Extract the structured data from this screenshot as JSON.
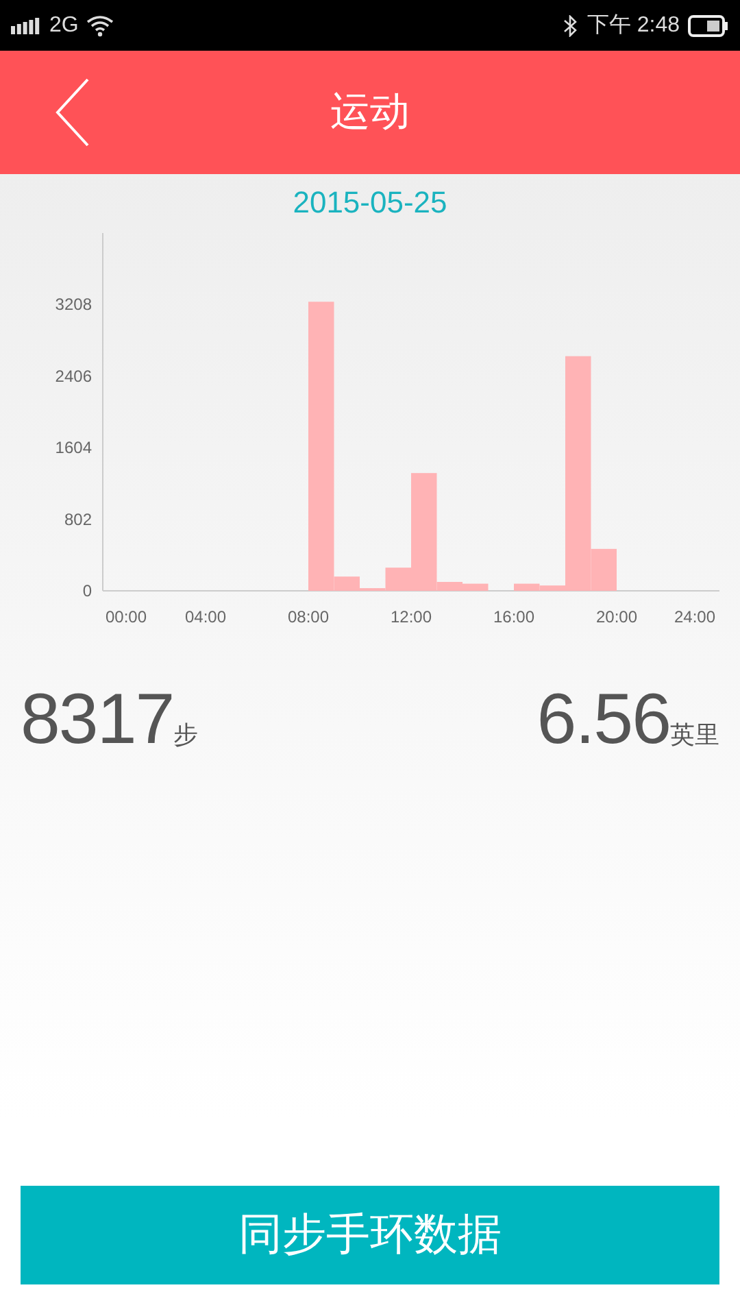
{
  "status_bar": {
    "network": "2G",
    "time": "下午 2:48"
  },
  "header": {
    "title": "运动"
  },
  "date": "2015-05-25",
  "chart_data": {
    "type": "bar",
    "x": [
      8.5,
      9.5,
      10.5,
      11.5,
      12.5,
      13.5,
      14.5,
      16.5,
      17.5,
      18.5,
      19.5
    ],
    "xlim": [
      0,
      24
    ],
    "series": [
      {
        "color": "#ffb3b5",
        "values": [
          3240,
          160,
          30,
          260,
          1320,
          100,
          80,
          80,
          60,
          2630,
          470
        ]
      }
    ],
    "ylim": [
      0,
      4010
    ],
    "yticks": [
      0,
      802,
      1604,
      2406,
      3208
    ],
    "xticks": [
      {
        "value": 0,
        "label": "00:00"
      },
      {
        "value": 4,
        "label": "04:00"
      },
      {
        "value": 8,
        "label": "08:00"
      },
      {
        "value": 12,
        "label": "12:00"
      },
      {
        "value": 16,
        "label": "16:00"
      },
      {
        "value": 20,
        "label": "20:00"
      },
      {
        "value": 24,
        "label": "24:00"
      }
    ]
  },
  "stats": [
    {
      "value": "8317",
      "unit": "步"
    },
    {
      "value": "6.56",
      "unit": "英里"
    }
  ],
  "sync_button": "同步手环数据"
}
